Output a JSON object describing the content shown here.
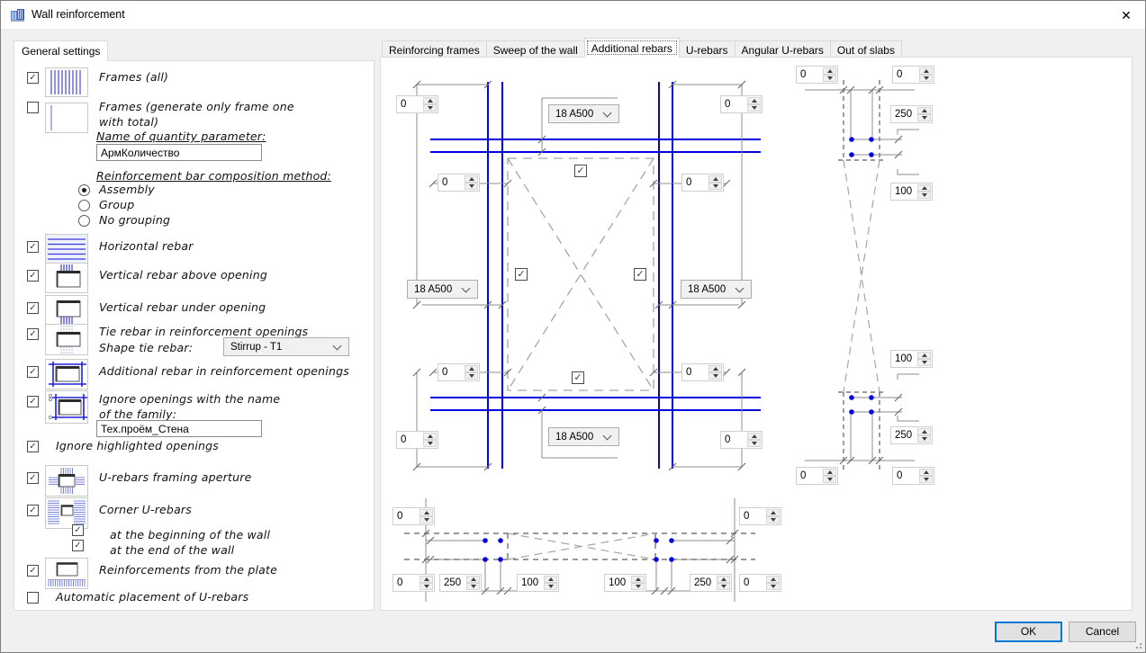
{
  "window": {
    "title": "Wall reinforcement"
  },
  "icons": {
    "close": "✕",
    "check": "✓"
  },
  "left_panel": {
    "tab": "General settings",
    "frames_all": "Frames (all)",
    "frames_one_line1": "Frames (generate only frame one",
    "frames_one_line2": "with total)",
    "qty_param_label": "Name of quantity parameter:",
    "qty_param_value": "АрмКоличество",
    "method_label": "Reinforcement bar composition method:",
    "method_assembly": "Assembly",
    "method_group": "Group",
    "method_none": "No grouping",
    "horizontal_rebar": "Horizontal rebar",
    "vertical_above": "Vertical rebar above opening",
    "vertical_under": "Vertical rebar under opening",
    "tie_rebar": "Tie rebar in reinforcement openings",
    "shape_tie_label": "Shape tie rebar:",
    "shape_tie_value": "Stirrup - T1",
    "additional_rebar": "Additional rebar in reinforcement openings",
    "ignore_name_line1": "Ignore openings with the name",
    "ignore_name_line2": "of the family:",
    "family_value": "Тех.проём_Стена",
    "ignore_highlighted": "Ignore highlighted openings",
    "u_rebars_framing": "U-rebars framing aperture",
    "corner_u_rebars": "Corner U-rebars",
    "at_beginning": "at the beginning of the wall",
    "at_end": "at the end of the wall",
    "from_plate": "Reinforcements from the plate",
    "auto_placement": "Automatic placement of U-rebars"
  },
  "tabs": {
    "items": [
      "Reinforcing frames",
      "Sweep of the wall",
      "Additional rebars",
      "U-rebars",
      "Angular U-rebars",
      "Out of slabs"
    ],
    "active": "Additional rebars"
  },
  "plan": {
    "grade_top": "18 A500",
    "grade_left": "18 A500",
    "grade_right": "18 A500",
    "grade_bottom": "18 A500",
    "off_tl": "0",
    "off_tr": "0",
    "off_mul": "0",
    "off_mur": "0",
    "off_mll": "0",
    "off_mlr": "0",
    "off_bl": "0",
    "off_br": "0"
  },
  "section_right": {
    "top_l": "0",
    "top_r": "0",
    "dim_250_top": "250",
    "dim_100_top": "100",
    "dim_100_bot": "100",
    "dim_250_bot": "250",
    "bot_l": "0",
    "bot_r": "0"
  },
  "section_bottom": {
    "top_l": "0",
    "top_r": "0",
    "r1": "0",
    "r2": "250",
    "r3": "100",
    "r4": "100",
    "r5": "250",
    "r6": "0"
  },
  "footer": {
    "ok": "OK",
    "cancel": "Cancel"
  },
  "colors": {
    "rebar_blue": "#0202e0",
    "accent": "#0078d7"
  }
}
